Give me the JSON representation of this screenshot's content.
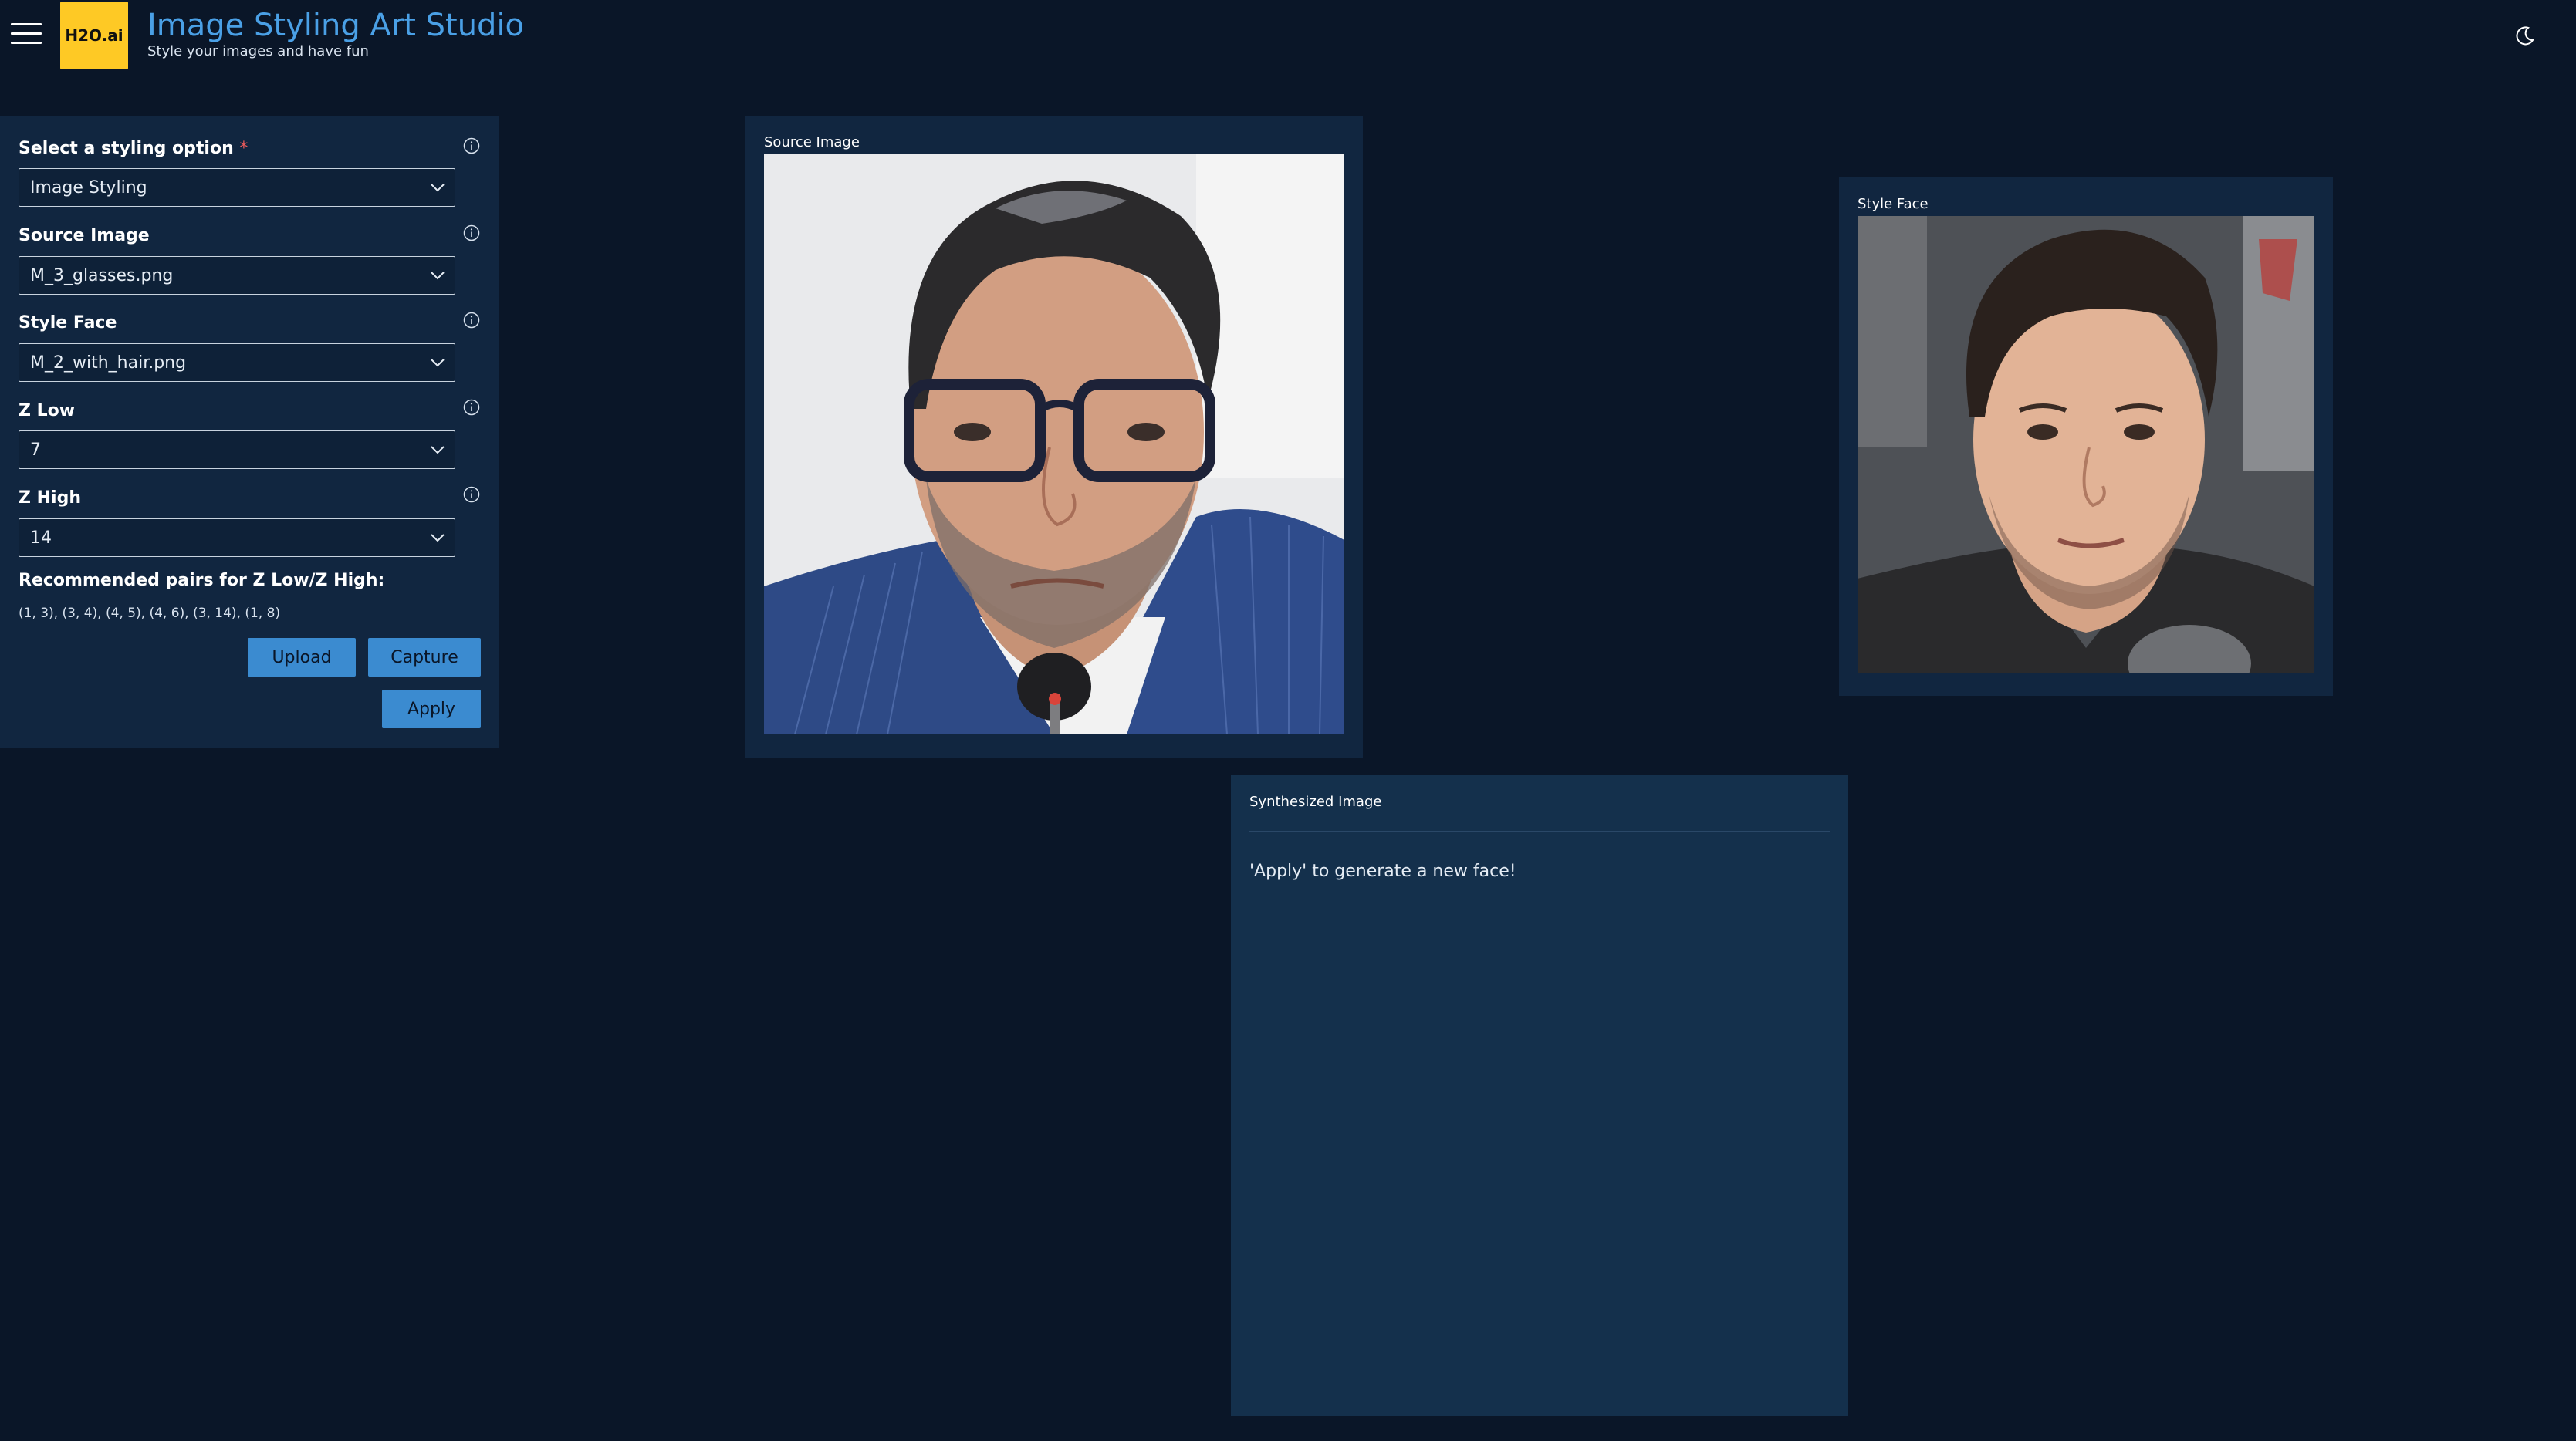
{
  "header": {
    "logo_text": "H2O.ai",
    "title": "Image Styling Art Studio",
    "subtitle": "Style your images and have fun"
  },
  "form": {
    "styling_option": {
      "label": "Select a styling option",
      "required_mark": "*",
      "value": "Image Styling"
    },
    "source_image": {
      "label": "Source Image",
      "value": "M_3_glasses.png"
    },
    "style_face": {
      "label": "Style Face",
      "value": "M_2_with_hair.png"
    },
    "z_low": {
      "label": "Z Low",
      "value": "7"
    },
    "z_high": {
      "label": "Z High",
      "value": "14"
    },
    "pairs_title": "Recommended pairs for Z Low/Z High:",
    "pairs_text": "(1, 3), (3, 4), (4, 5), (4, 6), (3, 14), (1, 8)",
    "upload_label": "Upload",
    "capture_label": "Capture",
    "apply_label": "Apply"
  },
  "source_card": {
    "label": "Source Image"
  },
  "style_card": {
    "label": "Style Face"
  },
  "synth_card": {
    "label": "Synthesized Image",
    "message": "'Apply' to generate a new face!"
  },
  "colors": {
    "background": "#0a1628",
    "card": "#112640",
    "accent": "#4aa0e6",
    "button": "#3b8bd0",
    "logo": "#fec925"
  },
  "icons": [
    "hamburger-menu-icon",
    "moon-icon",
    "info-icon",
    "chevron-down-icon"
  ]
}
